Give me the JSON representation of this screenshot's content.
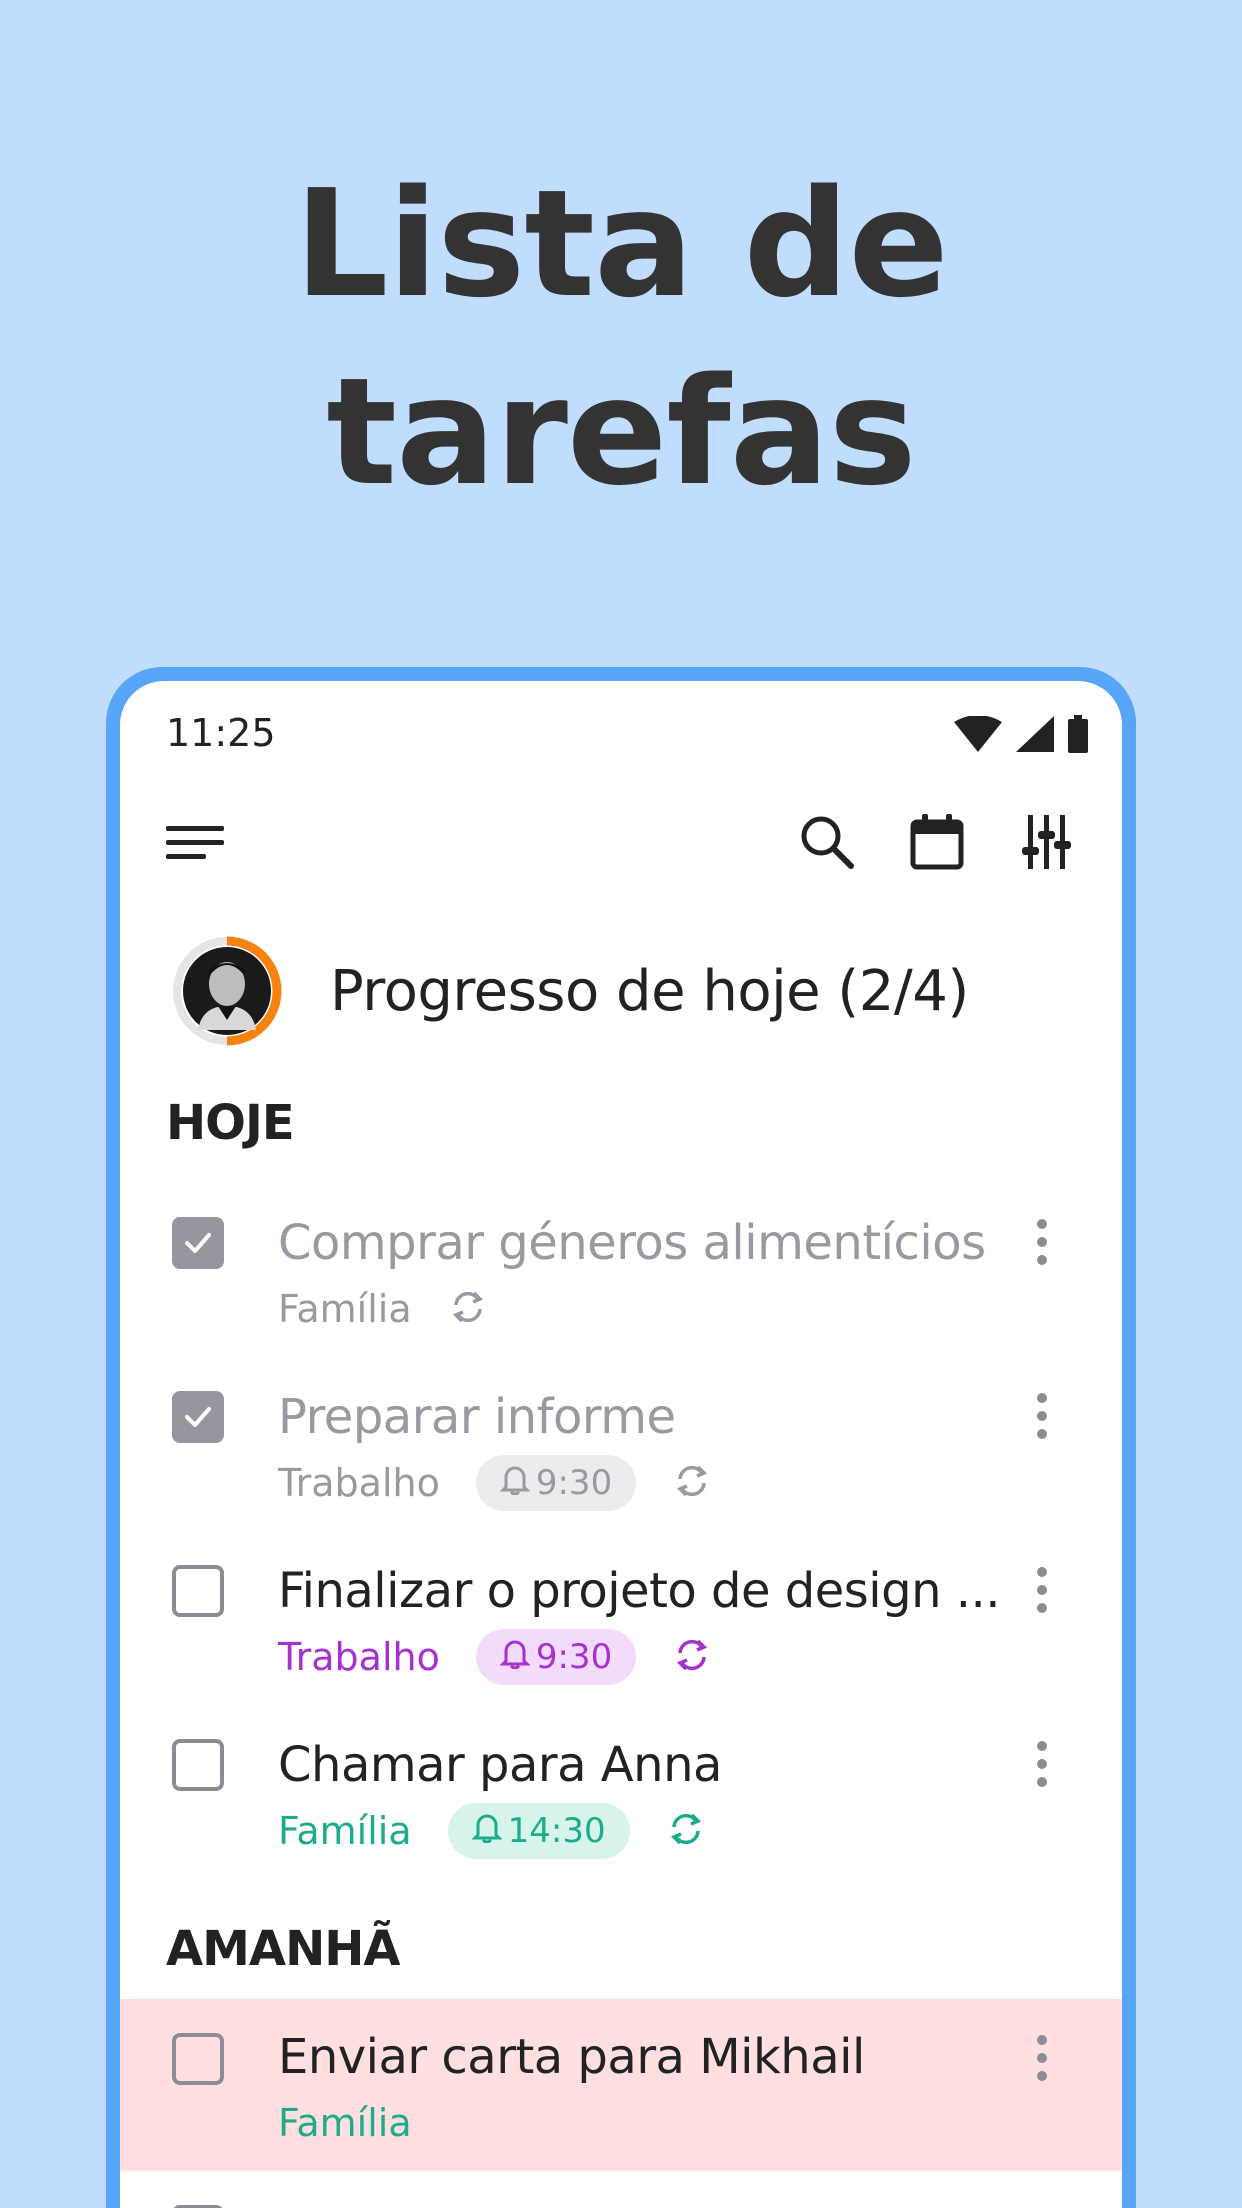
{
  "hero": {
    "line1": "Lista de",
    "line2": "tarefas"
  },
  "status_bar": {
    "time": "11:25",
    "icons": [
      "wifi-icon",
      "signal-icon",
      "battery-icon"
    ]
  },
  "toolbar": {
    "icons": [
      "menu-icon",
      "search-icon",
      "calendar-icon",
      "filter-icon"
    ]
  },
  "progress": {
    "label": "Progresso de hoje (2/4)",
    "done": 2,
    "total": 4,
    "ring_color": "#f7820f"
  },
  "sections": {
    "today": {
      "title": "HOJE",
      "tasks": [
        {
          "title": "Comprar géneros alimentícios",
          "category": "Família",
          "checked": true,
          "reminder": "",
          "repeat": true
        },
        {
          "title": "Preparar informe",
          "category": "Trabalho",
          "checked": true,
          "reminder": "9:30",
          "repeat": true
        },
        {
          "title": "Finalizar o projeto de design ...",
          "category": "Trabalho",
          "checked": false,
          "reminder": "9:30",
          "repeat": true
        },
        {
          "title": "Chamar para Anna",
          "category": "Família",
          "checked": false,
          "reminder": "14:30",
          "repeat": true
        }
      ]
    },
    "tomorrow": {
      "title": "AMANHÃ",
      "tasks": [
        {
          "title": "Enviar carta para Mikhail",
          "category": "Família",
          "checked": false,
          "reminder": "",
          "repeat": false
        }
      ]
    }
  },
  "colors": {
    "background": "#c1ddfd",
    "phone_frame": "#56a5f8",
    "done_gray": "#9a98a0",
    "work_purple": "#a532cf",
    "work_chip_bg": "#f3dcfb",
    "family_green": "#1eab8c",
    "family_chip_bg": "#d6f3ec",
    "gray_chip_bg": "#ececee",
    "overdue_bg": "#ffdfe0"
  }
}
